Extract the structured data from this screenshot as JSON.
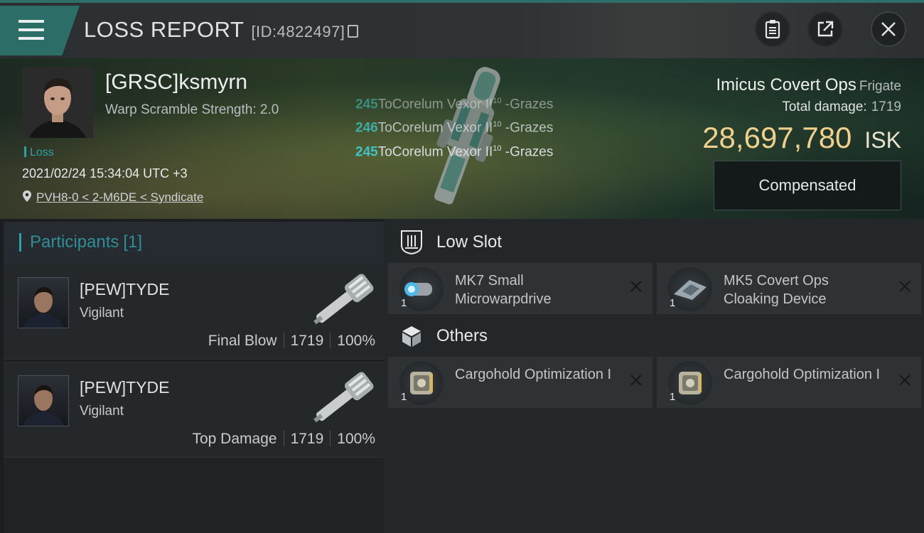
{
  "header": {
    "title": "LOSS REPORT",
    "report_id": "[ID:4822497]",
    "icons": [
      "menu-icon",
      "copy-icon",
      "clipboard-icon",
      "share-icon",
      "close-icon"
    ]
  },
  "victim": {
    "name": "[GRSC]ksmyrn",
    "scram_strength": "Warp Scramble Strength: 2.0",
    "tag": "Loss",
    "datetime": "2021/02/24 15:34:04 UTC +3",
    "location": "PVH8-0 < 2-M6DE < Syndicate"
  },
  "damage_log": [
    {
      "value": "245",
      "text": "ToCorelum Vexor II",
      "level": "10",
      "result": " -Grazes"
    },
    {
      "value": "246",
      "text": "ToCorelum Vexor II",
      "level": "10",
      "result": " -Grazes"
    },
    {
      "value": "245",
      "text": "ToCorelum Vexor II",
      "level": "10",
      "result": " -Grazes"
    }
  ],
  "ship": {
    "name": "Imicus Covert Ops",
    "class": "Frigate",
    "total_damage_label": "Total damage:",
    "total_damage": "1719",
    "isk_value": "28,697,780",
    "isk_unit": "ISK",
    "compensated_label": "Compensated"
  },
  "participants": {
    "label": "Participants",
    "count": "[1]",
    "rows": [
      {
        "name": "[PEW]TYDE",
        "ship": "Vigilant",
        "role": "Final Blow",
        "damage": "1719",
        "percent": "100%"
      },
      {
        "name": "[PEW]TYDE",
        "ship": "Vigilant",
        "role": "Top Damage",
        "damage": "1719",
        "percent": "100%"
      }
    ]
  },
  "sections": {
    "low_slot": {
      "label": "Low Slot",
      "modules": [
        {
          "qty": "1",
          "name": "MK7 Small Microwarpdrive"
        },
        {
          "qty": "1",
          "name": "MK5 Covert Ops Cloaking Device"
        }
      ]
    },
    "others": {
      "label": "Others",
      "modules": [
        {
          "qty": "1",
          "name": "Cargohold Optimization I"
        },
        {
          "qty": "1",
          "name": "Cargohold Optimization I"
        }
      ]
    }
  },
  "colors": {
    "accent_teal": "#2f9fa6",
    "isk_gold": "#efd08d",
    "header_tab": "#2d6d68",
    "damage_number": "#3ec3c0"
  }
}
